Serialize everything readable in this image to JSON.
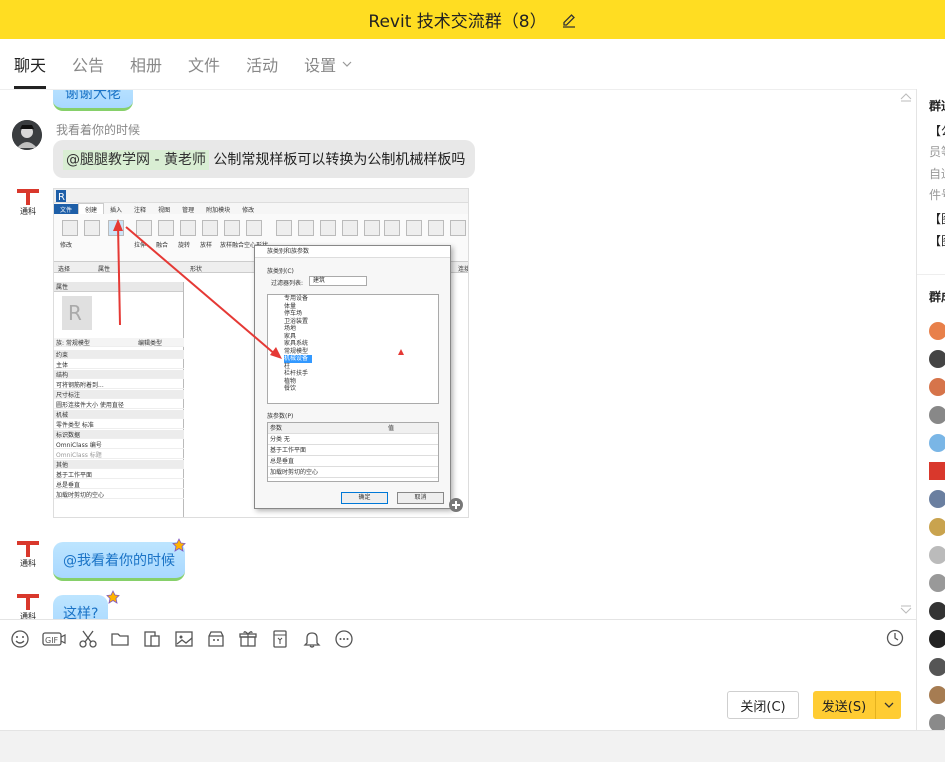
{
  "window": {
    "title": "Revit 技术交流群（8）"
  },
  "tabs": [
    {
      "label": "聊天"
    },
    {
      "label": "公告"
    },
    {
      "label": "相册"
    },
    {
      "label": "文件"
    },
    {
      "label": "活动"
    },
    {
      "label": "设置"
    }
  ],
  "messages": {
    "prev_bubble": "谢谢大佬",
    "msg1": {
      "sender": "我看着你的时候",
      "mention": "@腿腿教学网 - 黄老师",
      "text": "公制常规样板可以转换为公制机械样板吗"
    },
    "msg3": {
      "text": "@我看着你的时候"
    },
    "msg4": {
      "text": "这样?"
    },
    "logo_text": "通科"
  },
  "screenshot": {
    "ribbon_tabs": [
      "文件",
      "创建",
      "插入",
      "注释",
      "视图",
      "管理",
      "附加模块",
      "修改"
    ],
    "groups": [
      "选择",
      "属性",
      "形状",
      "连接"
    ],
    "tools": [
      "修改",
      "拉伸",
      "融合",
      "旋转",
      "放样",
      "放样融合",
      "空心形状"
    ],
    "props_title": "属性",
    "family_type": "族: 常规模型",
    "edit_type": "编辑类型",
    "prop_rows": [
      {
        "text": "约束",
        "sec": true
      },
      {
        "text": "主体",
        "sec": false
      },
      {
        "text": "结构",
        "sec": true
      },
      {
        "text": "可将钢筋附着到...",
        "sec": false
      },
      {
        "text": "尺寸标注",
        "sec": true
      },
      {
        "text": "圆形连接件大小   使用直径",
        "sec": false
      },
      {
        "text": "机械",
        "sec": true
      },
      {
        "text": "零件类型        标准",
        "sec": false
      },
      {
        "text": "标识数据",
        "sec": true
      },
      {
        "text": "OmniClass 编号",
        "sec": false
      },
      {
        "text": "OmniClass 标题",
        "sec": false
      },
      {
        "text": "其他",
        "sec": true
      },
      {
        "text": "基于工作平面",
        "sec": false
      },
      {
        "text": "总是垂直",
        "sec": false
      },
      {
        "text": "加载时剪切的空心",
        "sec": false
      }
    ],
    "dialog": {
      "title": "族类别和族参数",
      "category_label": "族类别(C)",
      "filter_label": "过滤器列表:",
      "filter_value": "建筑",
      "items": [
        "专用设备",
        "体量",
        "停车场",
        "卫浴装置",
        "场地",
        "家具",
        "家具系统",
        "常规模型",
        "机械设备",
        "柱",
        "栏杆扶手",
        "植物",
        "餐饮"
      ],
      "selected": "机械设备",
      "param_label": "族参数(P)",
      "param_header": [
        "参数",
        "值"
      ],
      "params": [
        "分类        无",
        "基于工作平面",
        "总是垂直",
        "加载时剪切的空心"
      ],
      "ok": "确定",
      "cancel": "取消"
    }
  },
  "input": {
    "close_label": "关闭(C)",
    "send_label": "发送(S)"
  },
  "right_panel": {
    "title1": "群通知",
    "notices": [
      "【公",
      "员等",
      "自适",
      "件号",
      "【图",
      "【图"
    ],
    "title2": "群成员"
  },
  "colors": {
    "titlebar": "#ffdd22",
    "send": "#ffcc33",
    "bubble_blue": "#bde5ff",
    "red_arrow": "#e53935"
  }
}
